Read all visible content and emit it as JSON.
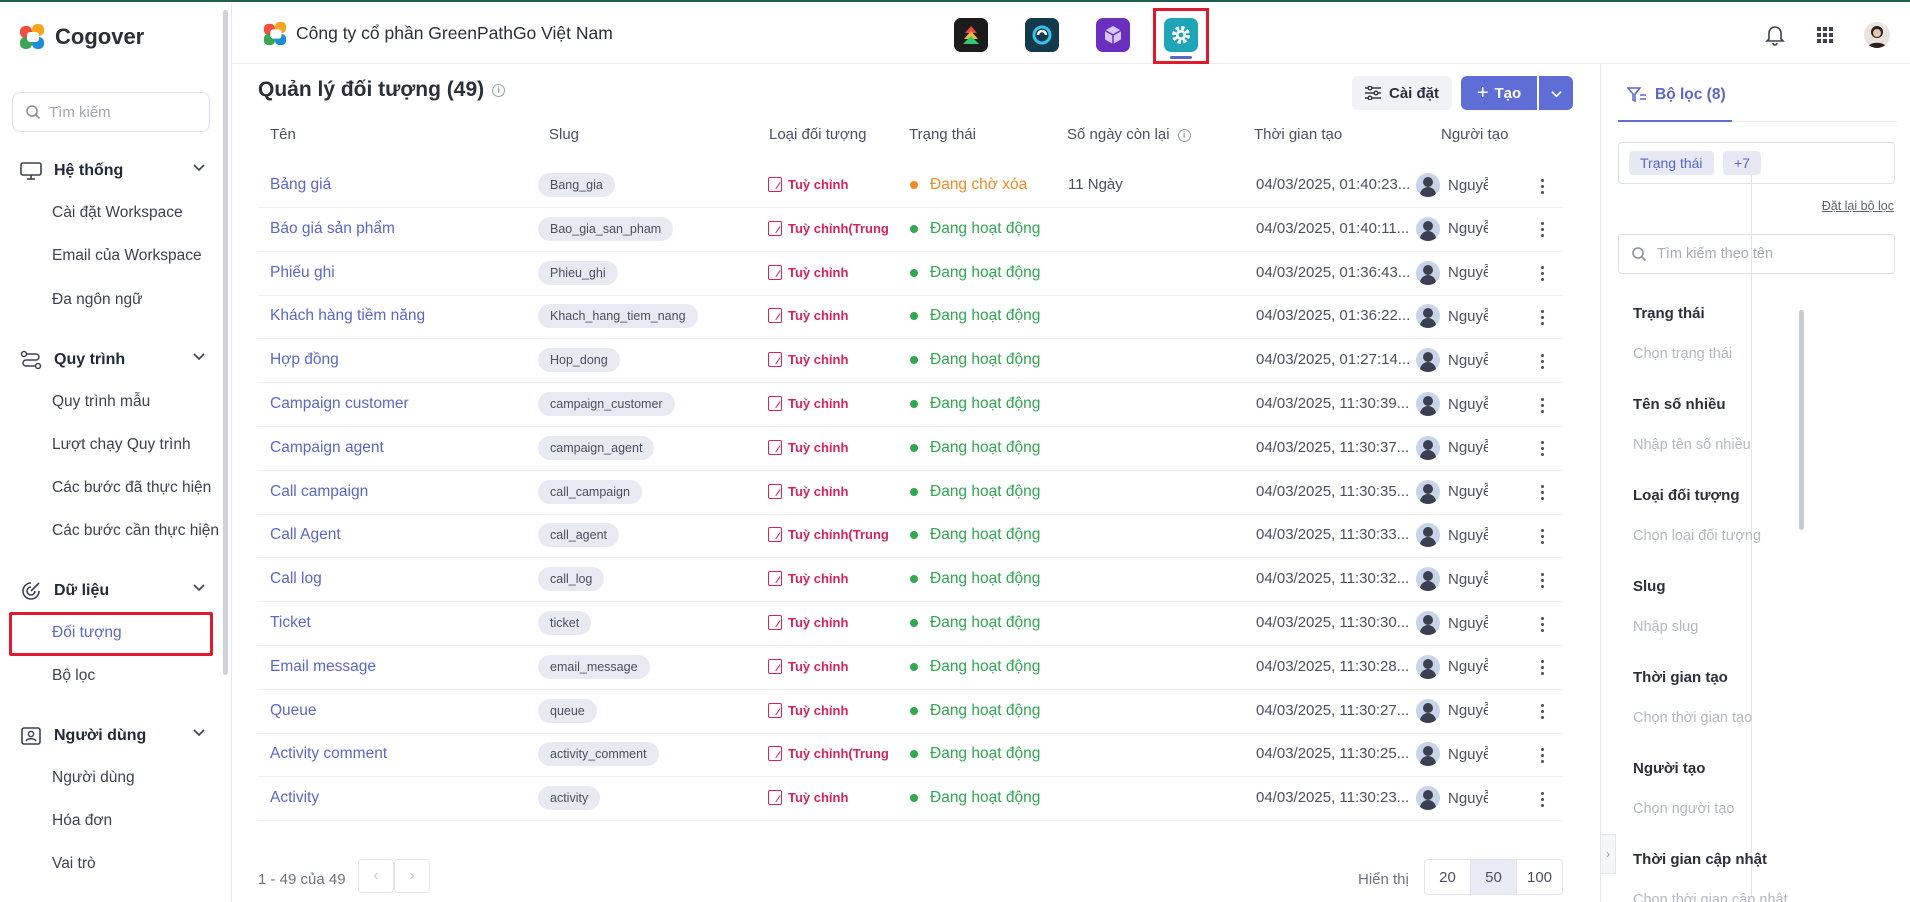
{
  "sidebar": {
    "brand": "Cogover",
    "search_placeholder": "Tìm kiếm",
    "groups": [
      {
        "label": "Hệ thống",
        "icon": "monitor-icon",
        "items": [
          "Cài đặt Workspace",
          "Email của Workspace",
          "Đa ngôn ngữ"
        ]
      },
      {
        "label": "Quy trình",
        "icon": "workflow-icon",
        "items": [
          "Quy trình mẫu",
          "Lượt chạy Quy trình",
          "Các bước đã thực hiện",
          "Các bước cần thực hiện"
        ]
      },
      {
        "label": "Dữ liệu",
        "icon": "data-icon",
        "items": [
          "Đối tượng",
          "Bộ lọc"
        ]
      },
      {
        "label": "Người dùng",
        "icon": "user-card-icon",
        "items": [
          "Người dùng",
          "Hóa đơn",
          "Vai trò"
        ]
      }
    ],
    "active_item": "Đối tượng"
  },
  "topbar": {
    "company": "Công ty cổ phần GreenPathGo Việt Nam",
    "apps": [
      "app-tree-icon",
      "app-link-icon",
      "app-cube-icon",
      "app-settings-icon"
    ],
    "active_app": "app-settings-icon"
  },
  "main": {
    "title": "Quản lý đối tượng (49)",
    "settings_label": "Cài đặt",
    "create_label": "Tạo",
    "columns": [
      "Tên",
      "Slug",
      "Loại đối tượng",
      "Trạng thái",
      "Số ngày còn lại",
      "Thời gian tạo",
      "Người tạo"
    ],
    "rows": [
      {
        "name": "Bảng giá",
        "slug": "Bang_gia",
        "type": "Tuỳ chỉnh",
        "status": "Đang chờ xóa",
        "days": "11 Ngày",
        "created": "04/03/2025, 01:40:23...",
        "user": "Nguyễ"
      },
      {
        "name": "Báo giá sản phẩm",
        "slug": "Bao_gia_san_pham",
        "type": "Tuỳ chỉnh(Trung",
        "status": "Đang hoạt động",
        "days": "",
        "created": "04/03/2025, 01:40:11...",
        "user": "Nguyễ"
      },
      {
        "name": "Phiếu ghi",
        "slug": "Phieu_ghi",
        "type": "Tuỳ chỉnh",
        "status": "Đang hoạt động",
        "days": "",
        "created": "04/03/2025, 01:36:43...",
        "user": "Nguyễ"
      },
      {
        "name": "Khách hàng tiềm năng",
        "slug": "Khach_hang_tiem_nang",
        "type": "Tuỳ chỉnh",
        "status": "Đang hoạt động",
        "days": "",
        "created": "04/03/2025, 01:36:22...",
        "user": "Nguyễ"
      },
      {
        "name": "Hợp đồng",
        "slug": "Hop_dong",
        "type": "Tuỳ chỉnh",
        "status": "Đang hoạt động",
        "days": "",
        "created": "04/03/2025, 01:27:14...",
        "user": "Nguyễ"
      },
      {
        "name": "Campaign customer",
        "slug": "campaign_customer",
        "type": "Tuỳ chỉnh",
        "status": "Đang hoạt động",
        "days": "",
        "created": "04/03/2025, 11:30:39...",
        "user": "Nguyễ"
      },
      {
        "name": "Campaign agent",
        "slug": "campaign_agent",
        "type": "Tuỳ chỉnh",
        "status": "Đang hoạt động",
        "days": "",
        "created": "04/03/2025, 11:30:37...",
        "user": "Nguyễ"
      },
      {
        "name": "Call campaign",
        "slug": "call_campaign",
        "type": "Tuỳ chỉnh",
        "status": "Đang hoạt động",
        "days": "",
        "created": "04/03/2025, 11:30:35...",
        "user": "Nguyễ"
      },
      {
        "name": "Call Agent",
        "slug": "call_agent",
        "type": "Tuỳ chỉnh(Trung",
        "status": "Đang hoạt động",
        "days": "",
        "created": "04/03/2025, 11:30:33...",
        "user": "Nguyễ"
      },
      {
        "name": "Call log",
        "slug": "call_log",
        "type": "Tuỳ chỉnh",
        "status": "Đang hoạt động",
        "days": "",
        "created": "04/03/2025, 11:30:32...",
        "user": "Nguyễ"
      },
      {
        "name": "Ticket",
        "slug": "ticket",
        "type": "Tuỳ chỉnh",
        "status": "Đang hoạt động",
        "days": "",
        "created": "04/03/2025, 11:30:30...",
        "user": "Nguyễ"
      },
      {
        "name": "Email message",
        "slug": "email_message",
        "type": "Tuỳ chỉnh",
        "status": "Đang hoạt động",
        "days": "",
        "created": "04/03/2025, 11:30:28...",
        "user": "Nguyễ"
      },
      {
        "name": "Queue",
        "slug": "queue",
        "type": "Tuỳ chỉnh",
        "status": "Đang hoạt động",
        "days": "",
        "created": "04/03/2025, 11:30:27...",
        "user": "Nguyễ"
      },
      {
        "name": "Activity comment",
        "slug": "activity_comment",
        "type": "Tuỳ chỉnh(Trung",
        "status": "Đang hoạt động",
        "days": "",
        "created": "04/03/2025, 11:30:25...",
        "user": "Nguyễ"
      },
      {
        "name": "Activity",
        "slug": "activity",
        "type": "Tuỳ chỉnh",
        "status": "Đang hoạt động",
        "days": "",
        "created": "04/03/2025, 11:30:23...",
        "user": "Nguyễ"
      }
    ],
    "pagination": {
      "range": "1 - 49 của 49",
      "show_label": "Hiển thị",
      "sizes": [
        "20",
        "50",
        "100"
      ],
      "selected": "50"
    }
  },
  "filter": {
    "tab_label": "Bộ lọc (8)",
    "chips": [
      "Trạng thái",
      "+7"
    ],
    "reset": "Đặt lại bộ lọc",
    "search_placeholder": "Tìm kiếm theo tên",
    "fields": [
      {
        "label": "Trạng thái",
        "placeholder": "Chọn trạng thái"
      },
      {
        "label": "Tên số nhiều",
        "placeholder": "Nhập tên số nhiều"
      },
      {
        "label": "Loại đối tượng",
        "placeholder": "Chọn loại đối tượng"
      },
      {
        "label": "Slug",
        "placeholder": "Nhập slug"
      },
      {
        "label": "Thời gian tạo",
        "placeholder": "Chọn thời gian tạo"
      },
      {
        "label": "Người tạo",
        "placeholder": "Chọn người tạo"
      },
      {
        "label": "Thời gian cập nhật",
        "placeholder": "Chọn thời gian cập nhật"
      }
    ]
  },
  "colors": {
    "accent": "#5f6dd6",
    "active_green": "#2fa84f",
    "pending_orange": "#f08a24",
    "custom_type": "#d4235a",
    "highlight_red": "#e0192c"
  }
}
